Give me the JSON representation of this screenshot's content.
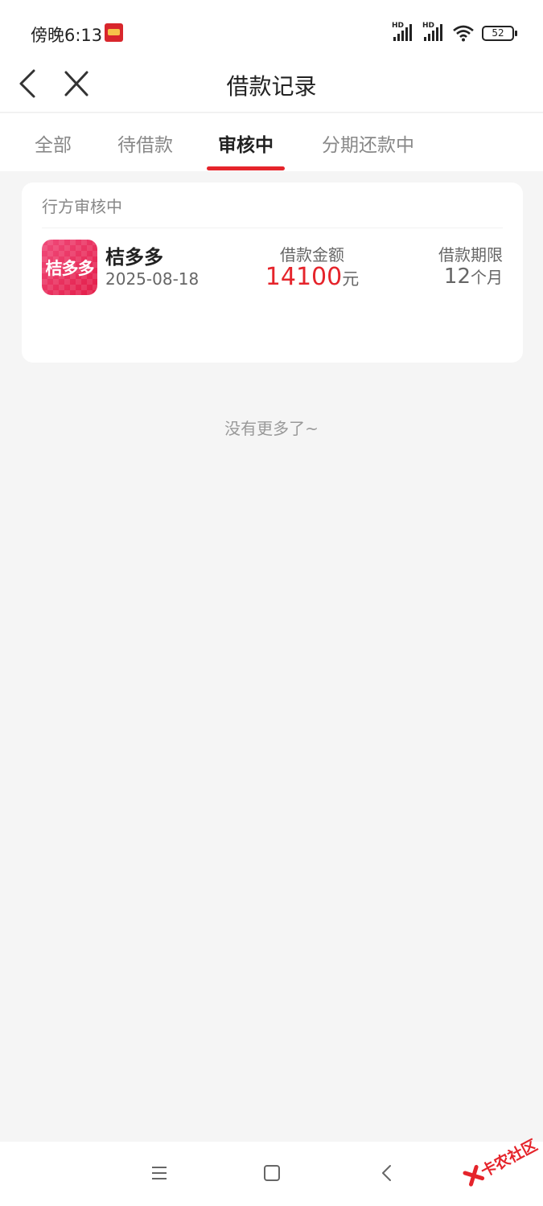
{
  "status_bar": {
    "time": "傍晚6:13",
    "signal_label_1": "HD",
    "signal_label_2": "HD",
    "battery": "52"
  },
  "nav": {
    "title": "借款记录"
  },
  "tabs": [
    {
      "label": "全部",
      "active": false
    },
    {
      "label": "待借款",
      "active": false
    },
    {
      "label": "审核中",
      "active": true
    },
    {
      "label": "分期还款中",
      "active": false
    }
  ],
  "record": {
    "status": "行方审核中",
    "lender_logo_text": "桔多多",
    "lender_name": "桔多多",
    "date": "2025-08-18",
    "amount_label": "借款金额",
    "amount": "14100",
    "amount_unit": "元",
    "term_label": "借款期限",
    "term": "12",
    "term_unit": "个月"
  },
  "list_footer": "没有更多了~",
  "watermark": "卡农社区",
  "colors": {
    "accent": "#e5242b",
    "background": "#f5f5f5",
    "card": "#ffffff"
  }
}
